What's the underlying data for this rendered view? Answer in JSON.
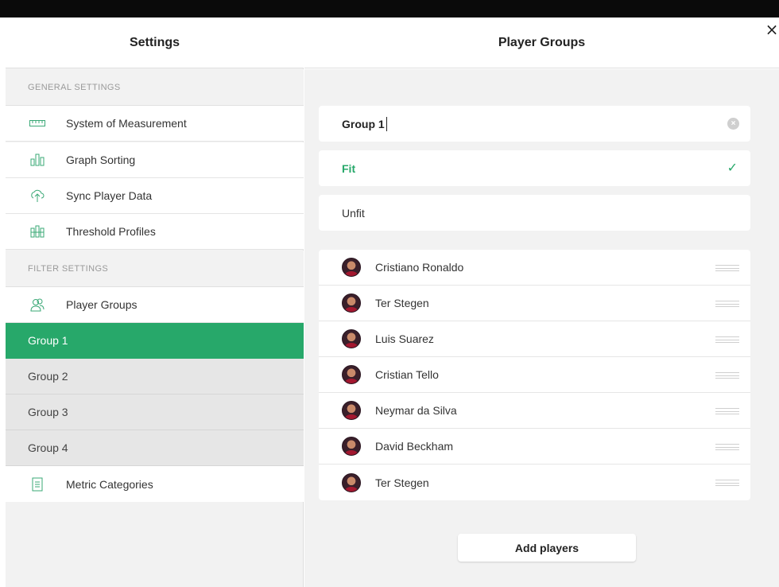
{
  "colors": {
    "accent": "#27a86a",
    "topbar": "#0a0a0a",
    "pane_bg": "#f2f2f2"
  },
  "close_label": "×",
  "left": {
    "title": "Settings",
    "general_label": "GENERAL SETTINGS",
    "general_items": [
      {
        "label": "System of Measurement",
        "icon": "ruler-icon"
      },
      {
        "label": "Graph Sorting",
        "icon": "bar-chart-icon"
      },
      {
        "label": "Sync Player Data",
        "icon": "cloud-sync-icon"
      },
      {
        "label": "Threshold Profiles",
        "icon": "threshold-chart-icon"
      }
    ],
    "filter_label": "FILTER SETTINGS",
    "player_groups_label": "Player Groups",
    "groups": [
      "Group 1",
      "Group 2",
      "Group 3",
      "Group 4"
    ],
    "active_group": "Group 1",
    "metric_label": "Metric Categories"
  },
  "right": {
    "title": "Player Groups",
    "group_name": "Group 1",
    "clear_label": "×",
    "options": [
      {
        "label": "Fit",
        "selected": true
      },
      {
        "label": "Unfit",
        "selected": false
      }
    ],
    "check_label": "✓",
    "players": [
      "Cristiano Ronaldo",
      "Ter Stegen",
      "Luis Suarez",
      "Cristian Tello",
      "Neymar da Silva",
      "David Beckham",
      "Ter Stegen"
    ],
    "add_button": "Add players"
  }
}
